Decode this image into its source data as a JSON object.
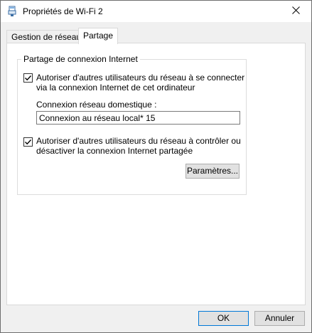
{
  "window": {
    "title": "Propriétés de Wi-Fi 2",
    "icon": "network-adapter-icon",
    "close_icon": "close-icon"
  },
  "tabs": [
    {
      "label": "Gestion de réseau",
      "active": false
    },
    {
      "label": "Partage",
      "active": true
    }
  ],
  "sharing": {
    "group_title": "Partage de connexion Internet",
    "allow_connect": {
      "checked": true,
      "label": "Autoriser d'autres utilisateurs du réseau à se connecter via la connexion Internet de cet ordinateur"
    },
    "home_network_label": "Connexion réseau domestique :",
    "home_network_value": "Connexion au réseau local* 15",
    "allow_control": {
      "checked": true,
      "label": "Autoriser d'autres utilisateurs du réseau à contrôler ou désactiver la connexion Internet partagée"
    },
    "settings_button": "Paramètres..."
  },
  "footer": {
    "ok_label": "OK",
    "cancel_label": "Annuler"
  },
  "colors": {
    "accent": "#0078d7",
    "window_bg": "#f0f0f0",
    "panel_bg": "#ffffff"
  }
}
